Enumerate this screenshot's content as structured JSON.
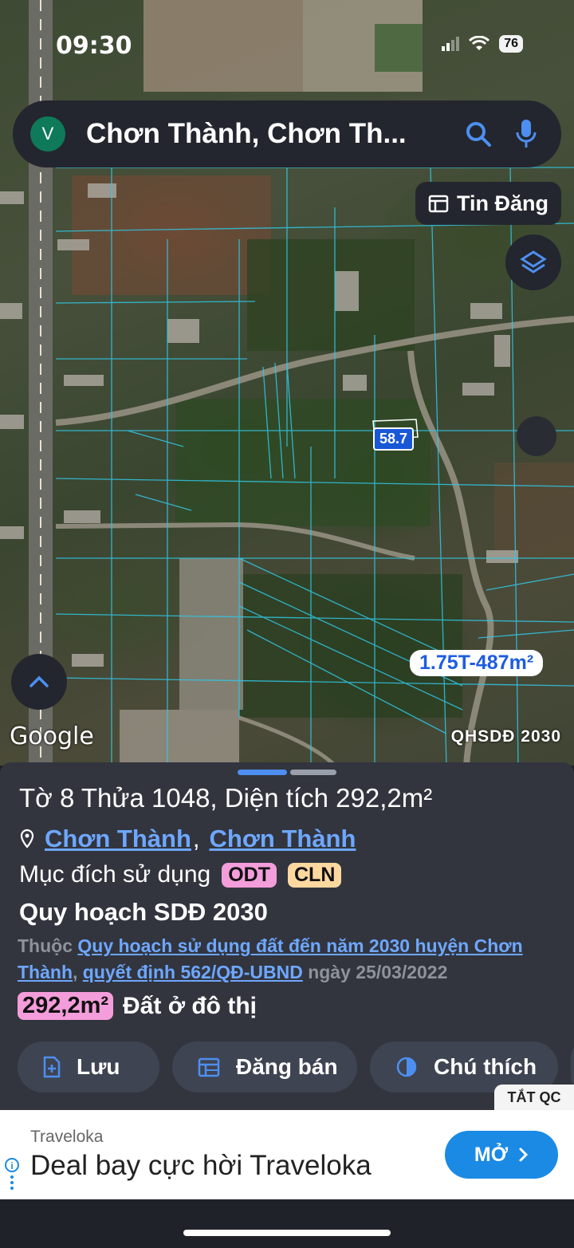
{
  "status": {
    "time": "09:30",
    "battery": "76"
  },
  "search": {
    "avatar_letter": "V",
    "query": "Chơn Thành, Chơn Th..."
  },
  "map": {
    "tin_dang_label": "Tin Đăng",
    "price_small": "58.7",
    "price_tag": "1.75T-487m²",
    "attribution": "Google",
    "layer_label": "QHSDĐ 2030"
  },
  "sheet": {
    "title": "Tờ 8 Thửa 1048, Diện tích 292,2m²",
    "location_ward": "Chơn Thành",
    "location_district": "Chơn Thành",
    "location_separator": ",",
    "purpose_label": "Mục đích sử dụng",
    "purpose_tags": [
      "ODT",
      "CLN"
    ],
    "plan_title": "Quy hoạch SDĐ 2030",
    "plan_prefix": "Thuộc",
    "plan_link": "Quy hoạch sử dụng đất đến năm 2030 huyện Chơn Thành",
    "plan_sep": ",",
    "decision_link": "quyết định 562/QĐ-UBND",
    "decision_date": "ngày 25/03/2022",
    "area_value": "292,2m²",
    "area_type": "Đất ở đô thị",
    "actions": {
      "save": "Lưu",
      "post_sale": "Đăng bán",
      "legend": "Chú thích"
    }
  },
  "ad": {
    "close_label": "TẮT QC",
    "brand": "Traveloka",
    "headline": "Deal bay cực hời Traveloka",
    "cta": "MỞ"
  },
  "colors": {
    "accent_blue": "#6ea7ff",
    "odt_pink": "#f49ddb",
    "cln_peach": "#ffd8a0",
    "cta_blue": "#1a8ae5"
  }
}
